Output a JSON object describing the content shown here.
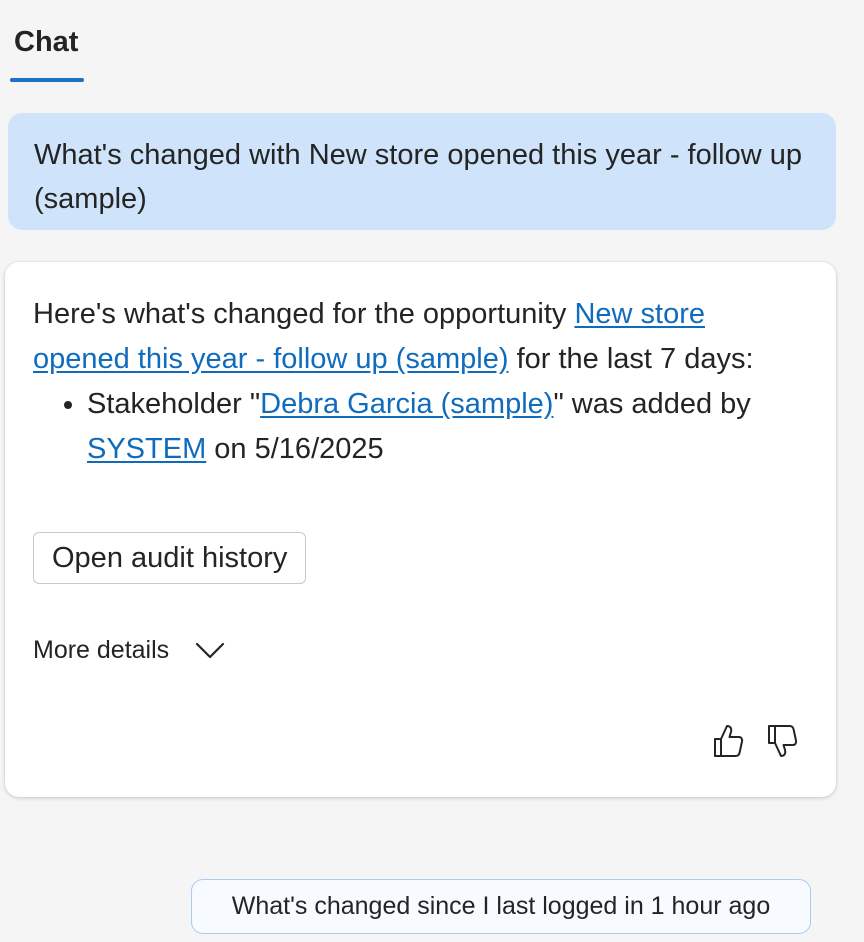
{
  "tab": {
    "label": "Chat"
  },
  "user_message": {
    "text": "What's changed with New store opened this year - follow up (sample)"
  },
  "response": {
    "intro_before": "Here's what's changed for the opportunity ",
    "opportunity_link": "New store opened this year - follow up (sample)",
    "intro_after": " for the last 7 days:",
    "bullets": [
      {
        "prefix": "Stakeholder \"",
        "stakeholder_link": "Debra Garcia (sample)",
        "middle": "\" was added by ",
        "user_link": "SYSTEM",
        "suffix": " on 5/16/2025"
      }
    ],
    "audit_button": "Open audit history",
    "more_details": "More details",
    "feedback": {
      "like_icon": "thumbs-up-icon",
      "dislike_icon": "thumbs-down-icon"
    }
  },
  "suggestion": {
    "text": "What's changed since I last logged in 1 hour ago"
  },
  "colors": {
    "background": "#f5f5f5",
    "user_bubble": "#cfe3fa",
    "link": "#0f6cbd",
    "tab_underline": "#1f6fc4",
    "suggestion_border": "#a9cdf2"
  }
}
